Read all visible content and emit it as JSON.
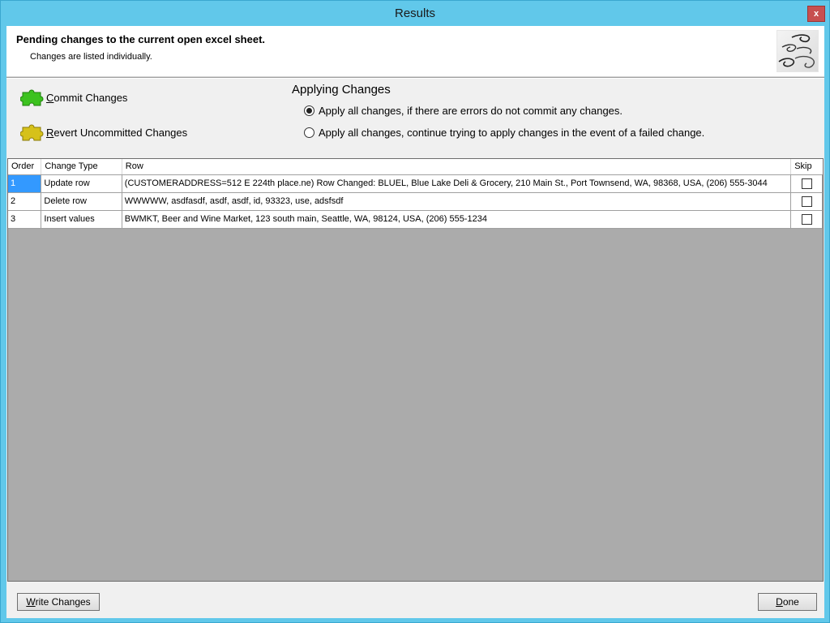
{
  "window": {
    "title": "Results",
    "close_label": "x"
  },
  "header": {
    "title": "Pending changes to the current open excel sheet.",
    "subtitle": "Changes are listed individually."
  },
  "actions": {
    "commit": {
      "first": "C",
      "rest": "ommit Changes"
    },
    "revert": {
      "first": "R",
      "rest": "evert Uncommitted Changes"
    }
  },
  "applying": {
    "title": "Applying Changes",
    "options": [
      {
        "label": "Apply all changes, if there are errors do not commit any changes.",
        "selected": true
      },
      {
        "label": "Apply all changes, continue trying to apply changes in the event of a failed change.",
        "selected": false
      }
    ]
  },
  "grid": {
    "columns": [
      "Order",
      "Change Type",
      "Row",
      "Skip"
    ],
    "rows": [
      {
        "order": "1",
        "type": "Update row",
        "row": "(CUSTOMERADDRESS=512 E 224th place.ne)   Row Changed: BLUEL, Blue Lake Deli & Grocery, 210 Main St., Port Townsend, WA, 98368, USA, (206) 555-3044",
        "skip": false
      },
      {
        "order": "2",
        "type": "Delete row",
        "row": "WWWWW, asdfasdf, asdf, asdf, id, 93323, use, adsfsdf",
        "skip": false
      },
      {
        "order": "3",
        "type": "Insert values",
        "row": "BWMKT, Beer and Wine Market, 123 south main, Seattle, WA, 98124, USA, (206) 555-1234",
        "skip": false
      }
    ]
  },
  "buttons": {
    "write": {
      "first": "W",
      "rest": "rite Changes"
    },
    "done": {
      "first": "D",
      "rest": "one"
    }
  },
  "colors": {
    "titlebar": "#61c8ea",
    "close": "#c75050",
    "selection": "#3399ff",
    "grid_background": "#ababab",
    "commit_icon": "#3cc21f",
    "revert_icon": "#d6c11a"
  },
  "icons": {
    "commit": "puzzle-piece-green-icon",
    "revert": "puzzle-piece-yellow-icon",
    "header": "swirl-graphic-icon"
  }
}
